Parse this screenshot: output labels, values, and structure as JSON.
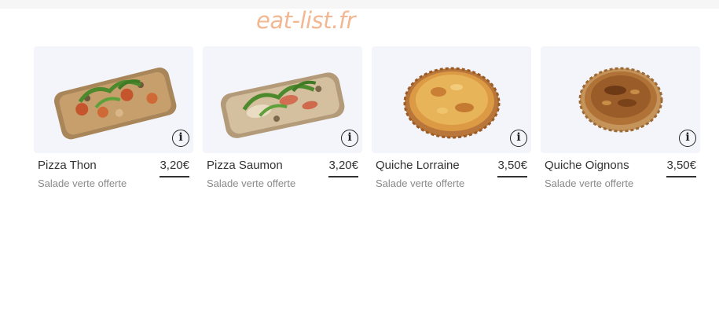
{
  "watermark": "eat-list.fr",
  "products": [
    {
      "name": "Pizza Thon",
      "price": "3,20€",
      "subtitle": "Salade verte offerte",
      "image_icon": "pizza-thon-image",
      "info_icon": "info-icon",
      "info_glyph": "i"
    },
    {
      "name": "Pizza Saumon",
      "price": "3,20€",
      "subtitle": "Salade verte offerte",
      "image_icon": "pizza-saumon-image",
      "info_icon": "info-icon",
      "info_glyph": "i"
    },
    {
      "name": "Quiche Lorraine",
      "price": "3,50€",
      "subtitle": "Salade verte offerte",
      "image_icon": "quiche-lorraine-image",
      "info_icon": "info-icon",
      "info_glyph": "i"
    },
    {
      "name": "Quiche Oignons",
      "price": "3,50€",
      "subtitle": "Salade verte offerte",
      "image_icon": "quiche-oignons-image",
      "info_icon": "info-icon",
      "info_glyph": "i"
    }
  ],
  "colors": {
    "watermark": "#f2b893",
    "text": "#333333",
    "subtitle": "#8a8a8a",
    "photo_background": "#f4f5fa"
  }
}
